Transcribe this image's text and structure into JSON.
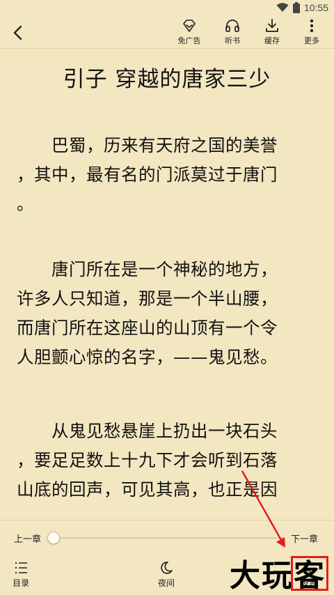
{
  "status": {
    "time": "10:55"
  },
  "toolbar": {
    "no_ads_label": "免广告",
    "listen_label": "听书",
    "cache_label": "缓存",
    "more_label": "更多"
  },
  "chapter": {
    "title": "引子 穿越的唐家三少",
    "paragraphs": [
      [
        "　　巴蜀，历来有天府之国的美誉",
        "，其中，最有名的门派莫过于唐门",
        "。"
      ],
      [
        "　　唐门所在是一个神秘的地方，",
        "许多人只知道，那是一个半山腰，",
        "而唐门所在这座山的山顶有一个令",
        "人胆颤心惊的名字，——鬼见愁。"
      ],
      [
        "　　从鬼见愁悬崖上扔出一块石头",
        "，要足足数上十九下才会听到石落",
        "山底的回声，可见其高，也正是因"
      ]
    ]
  },
  "progress": {
    "prev_label": "上一章",
    "next_label": "下一章",
    "position": 0.0
  },
  "bottom_menu": {
    "catalog_label": "目录",
    "night_label": "夜间",
    "settings_label": "设置"
  },
  "watermark": {
    "text": "大玩客"
  },
  "colors": {
    "background": "#f3e7c2",
    "text": "#111111",
    "highlight": "#e01d1d"
  }
}
